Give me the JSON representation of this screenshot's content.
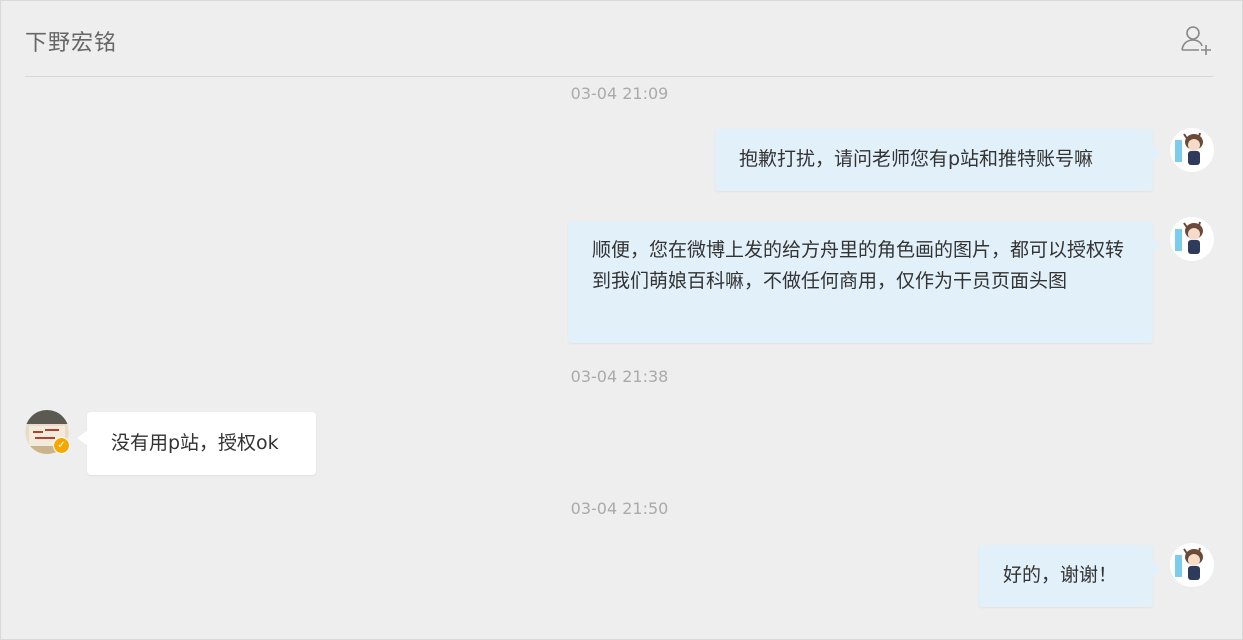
{
  "header": {
    "title": "下野宏铭",
    "add_user_icon": "add-user-icon"
  },
  "messages": [
    {
      "type": "time",
      "text": "03-04 21:09"
    },
    {
      "type": "message",
      "sender": "self",
      "text": "抱歉打扰，请问老师您有p站和推特账号嘛"
    },
    {
      "type": "message",
      "sender": "self",
      "text": "顺便，您在微博上发的给方舟里的角色画的图片，都可以授权转到我们萌娘百科嘛，不做任何商用，仅作为干员页面头图"
    },
    {
      "type": "time",
      "text": "03-04 21:38"
    },
    {
      "type": "message",
      "sender": "other",
      "text": "没有用p站，授权ok"
    },
    {
      "type": "time",
      "text": "03-04 21:50"
    },
    {
      "type": "message",
      "sender": "self",
      "text": "好的，谢谢！"
    }
  ],
  "colors": {
    "background": "#eeeeee",
    "self_bubble": "#e2f0fa",
    "other_bubble": "#ffffff",
    "timestamp": "#aaaaaa",
    "verified_badge": "#f5a800"
  }
}
